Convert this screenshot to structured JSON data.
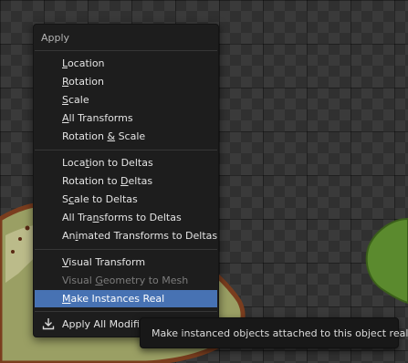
{
  "menu": {
    "title": "Apply",
    "groups": [
      [
        {
          "pre": "",
          "mn": "L",
          "post": "ocation"
        },
        {
          "pre": "",
          "mn": "R",
          "post": "otation"
        },
        {
          "pre": "",
          "mn": "S",
          "post": "cale"
        },
        {
          "pre": "",
          "mn": "A",
          "post": "ll Transforms"
        },
        {
          "pre": "Rotation ",
          "mn": "&",
          "post": " Scale"
        }
      ],
      [
        {
          "pre": "Loca",
          "mn": "t",
          "post": "ion to Deltas"
        },
        {
          "pre": "Rotation to ",
          "mn": "D",
          "post": "eltas"
        },
        {
          "pre": "S",
          "mn": "c",
          "post": "ale to Deltas"
        },
        {
          "pre": "All Tra",
          "mn": "n",
          "post": "sforms to Deltas"
        },
        {
          "pre": "An",
          "mn": "i",
          "post": "mated Transforms to Deltas"
        }
      ],
      [
        {
          "pre": "",
          "mn": "V",
          "post": "isual Transform"
        },
        {
          "pre": "Visual ",
          "mn": "G",
          "post": "eometry to Mesh"
        },
        {
          "pre": "",
          "mn": "M",
          "post": "ake Instances Real"
        }
      ]
    ],
    "apply_all": {
      "icon": "import-download-icon",
      "label": "Apply All Modifiers"
    }
  },
  "tooltip": {
    "text": "Make instanced objects attached to this object real."
  },
  "colors": {
    "highlight": "#4772b3",
    "menu_bg": "#1d1d1d",
    "disabled_text": "#7c7c7c"
  }
}
